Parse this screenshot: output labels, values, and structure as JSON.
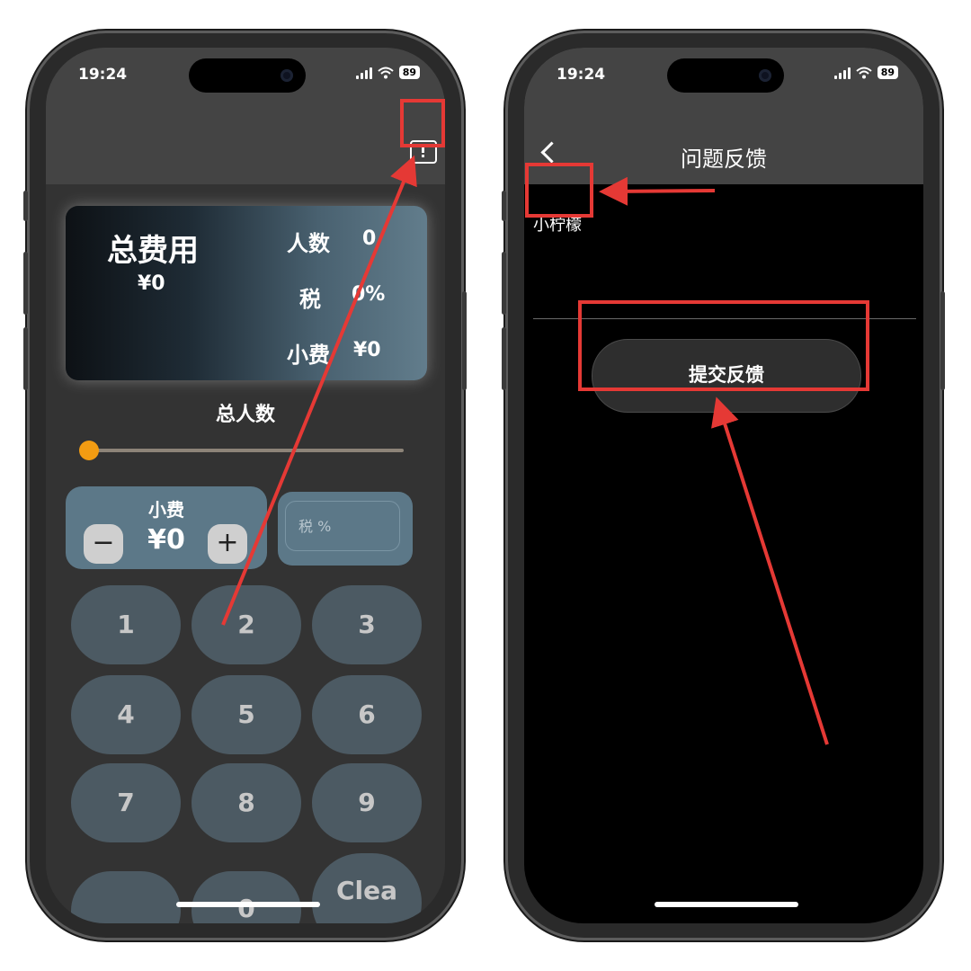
{
  "status_bar": {
    "time": "19:24",
    "battery": "89"
  },
  "left_screen": {
    "summary": {
      "title": "总费用",
      "total": "¥0",
      "people_label": "人数",
      "people_value": "0",
      "tax_label": "税",
      "tax_value": "0%",
      "tip_label": "小费",
      "tip_value": "¥0"
    },
    "slider": {
      "title": "总人数",
      "value": 0
    },
    "tip": {
      "label": "小费",
      "value": "¥0",
      "minus": "−",
      "plus": "+"
    },
    "tax_input": {
      "placeholder": "税 %"
    },
    "keypad": [
      "1",
      "2",
      "3",
      "4",
      "5",
      "6",
      "7",
      "8",
      "9",
      ".",
      "0",
      "Clea"
    ]
  },
  "right_screen": {
    "nav_title": "问题反馈",
    "feedback_text": "小柠檬",
    "submit_label": "提交反馈"
  },
  "colors": {
    "annotation": "#e53935",
    "slider_thumb": "#f39c12",
    "card_accent": "#5c7888"
  }
}
